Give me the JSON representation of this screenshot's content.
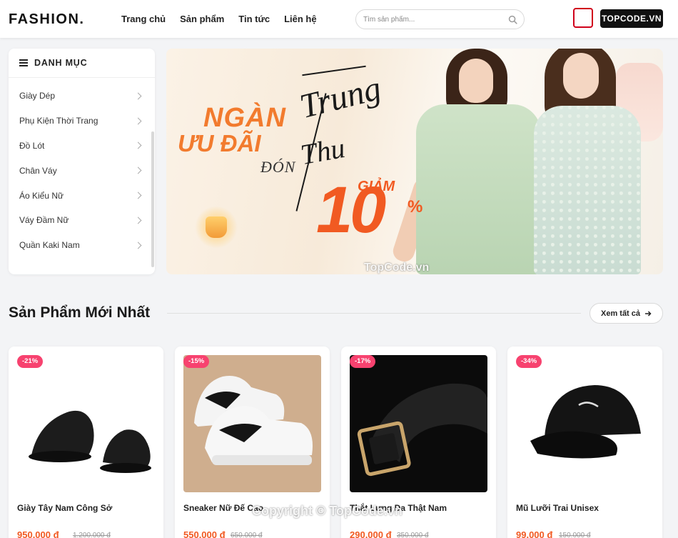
{
  "header": {
    "logo": "FASHION.",
    "nav": [
      "Trang chủ",
      "Sản phẩm",
      "Tin tức",
      "Liên hệ"
    ],
    "search_placeholder": "Tìm sản phẩm...",
    "brand_text": "TOPCODE.VN"
  },
  "sidebar": {
    "title": "DANH MỤC",
    "items": [
      "Giày Dép",
      "Phụ Kiện Thời Trang",
      "Đồ Lót",
      "Chân Váy",
      "Áo Kiểu Nữ",
      "Váy Đầm Nữ",
      "Quần Kaki Nam"
    ]
  },
  "banner": {
    "line1": "NGÀN",
    "line2": "ƯU ĐÃI",
    "don": "ĐÓN",
    "trung": "Trung",
    "thu": "Thu",
    "giam": "GIẢM",
    "percent": "10",
    "percent_sign": "%"
  },
  "watermarks": [
    "TopCode.vn",
    "Copyright © TopCode.vn"
  ],
  "section": {
    "title": "Sản Phẩm Mới Nhất",
    "see_all": "Xem tất cả"
  },
  "products": [
    {
      "badge": "-21%",
      "name": "Giày Tây Nam Công Sở",
      "price": "950.000 đ",
      "old_price": "1.200.000 đ"
    },
    {
      "badge": "-15%",
      "name": "Sneaker Nữ Đế Cao",
      "price": "550.000 đ",
      "old_price": "650.000 đ"
    },
    {
      "badge": "-17%",
      "name": "Thắt Lưng Da Thật Nam",
      "price": "290.000 đ",
      "old_price": "350.000 đ"
    },
    {
      "badge": "-34%",
      "name": "Mũ Lưỡi Trai Unisex",
      "price": "99.000 đ",
      "old_price": "150.000 đ"
    }
  ]
}
